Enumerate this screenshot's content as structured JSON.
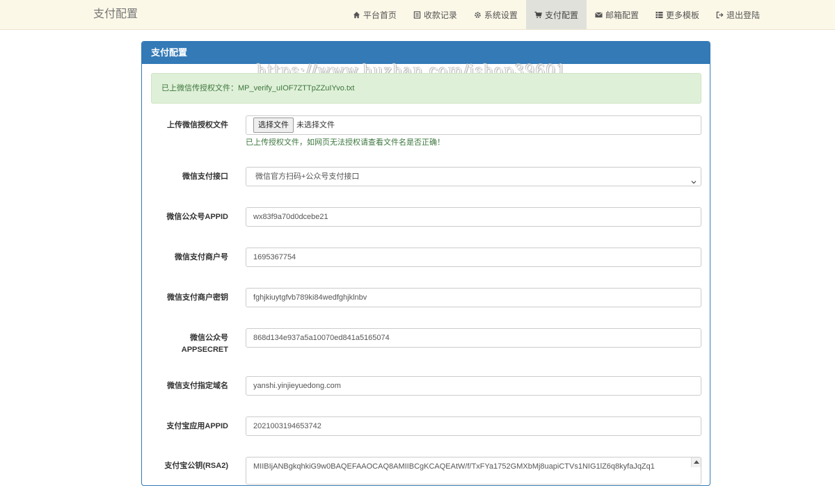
{
  "navbar": {
    "brand": "支付配置",
    "items": [
      {
        "label": "平台首页",
        "icon": "home-icon",
        "active": false
      },
      {
        "label": "收款记录",
        "icon": "list-icon",
        "active": false
      },
      {
        "label": "系统设置",
        "icon": "gear-icon",
        "active": false
      },
      {
        "label": "支付配置",
        "icon": "cart-icon",
        "active": true
      },
      {
        "label": "邮箱配置",
        "icon": "envelope-icon",
        "active": false
      },
      {
        "label": "更多模板",
        "icon": "th-list-icon",
        "active": false
      },
      {
        "label": "退出登陆",
        "icon": "logout-icon",
        "active": false
      }
    ]
  },
  "panel": {
    "title": "支付配置",
    "watermark": "https://www.huzhan.com/ishop39601",
    "alert": "已上微信传授权文件：MP_verify_uIOF7ZTTpZZuIYvo.txt"
  },
  "form": {
    "upload": {
      "label": "上传微信授权文件",
      "button": "选择文件",
      "status": "未选择文件",
      "help": "已上传授权文件，如网页无法授权请查看文件名是否正确！"
    },
    "wx_interface": {
      "label": "微信支付接口",
      "value": "微信官方扫码+公众号支付接口"
    },
    "wx_appid": {
      "label": "微信公众号APPID",
      "value": "wx83f9a70d0dcebe21"
    },
    "wx_mchid": {
      "label": "微信支付商户号",
      "value": "1695367754"
    },
    "wx_key": {
      "label": "微信支付商户密钥",
      "value": "fghjkiuytgfvb789ki84wedfghjklnbv"
    },
    "wx_secret": {
      "label_line1": "微信公众号",
      "label_line2": "APPSECRET",
      "value": "868d134e937a5a10070ed841a5165074"
    },
    "wx_domain": {
      "label": "微信支付指定域名",
      "value": "yanshi.yinjieyuedong.com"
    },
    "ali_appid": {
      "label": "支付宝应用APPID",
      "value": "2021003194653742"
    },
    "ali_pubkey": {
      "label": "支付宝公钥(RSA2)",
      "value": "MIIBIjANBgkqhkiG9w0BAQEFAAOCAQ8AMIIBCgKCAQEAtW/f/TxFYa1752GMXbMj8uapiCTVs1NIG1lZ6q8kyfaJqZq1"
    }
  }
}
